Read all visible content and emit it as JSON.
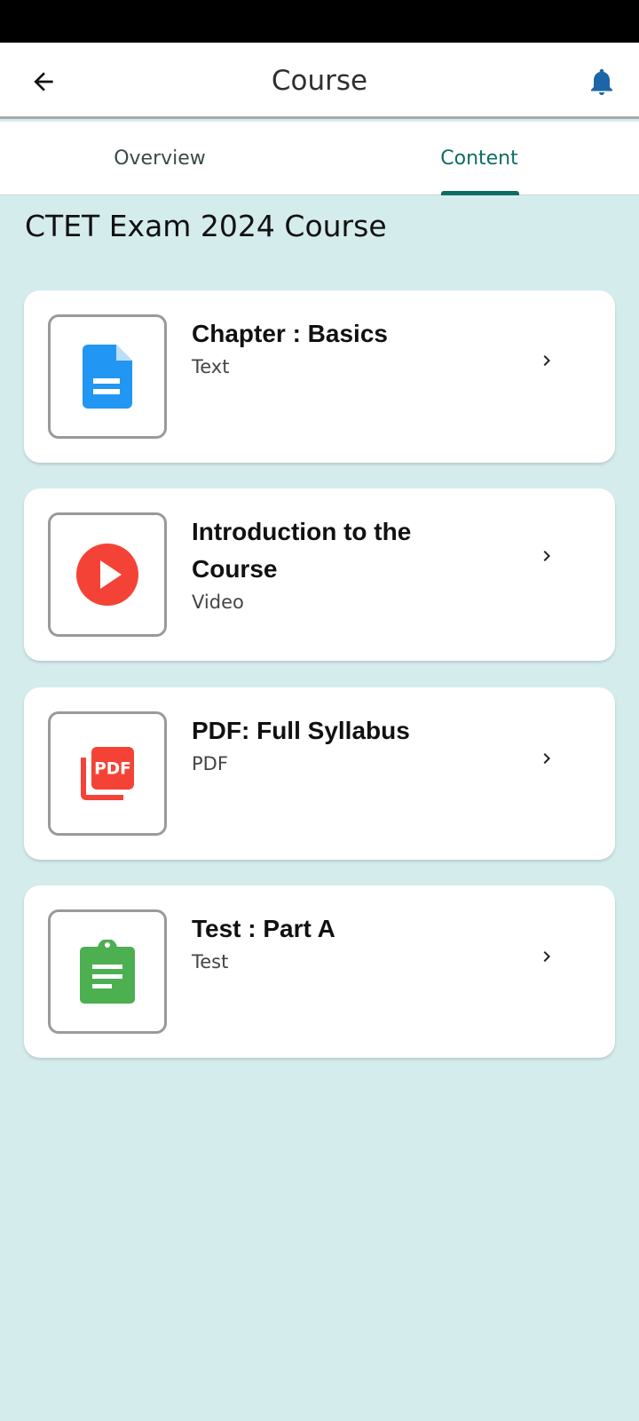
{
  "app_bar": {
    "title": "Course",
    "back_icon": "arrow-back-icon",
    "bell_icon": "bell-icon",
    "bell_color": "#1b66a8"
  },
  "tabs": [
    {
      "label": "Overview",
      "selected": false
    },
    {
      "label": "Content",
      "selected": true
    }
  ],
  "accent_color": "#0e6d62",
  "course_title": "CTET Exam 2024 Course",
  "items": [
    {
      "title": "Chapter : Basics",
      "type": "Text",
      "icon": "document-icon",
      "icon_color": "#2196f3"
    },
    {
      "title": "Introduction to the Course",
      "type": "Video",
      "icon": "play-video-icon",
      "icon_color": "#f44336"
    },
    {
      "title": "PDF: Full Syllabus",
      "type": "PDF",
      "icon": "pdf-icon",
      "icon_color": "#f44336"
    },
    {
      "title": "Test : Part A",
      "type": "Test",
      "icon": "clipboard-icon",
      "icon_color": "#4caf50"
    }
  ]
}
